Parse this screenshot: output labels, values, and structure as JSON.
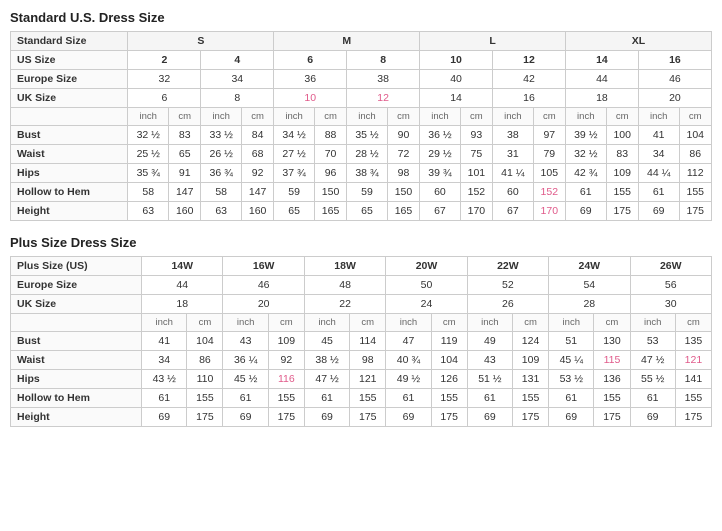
{
  "standardTitle": "Standard U.S. Dress Size",
  "plusTitle": "Plus Size Dress Size",
  "standard": {
    "sizeGroups": [
      "S",
      "M",
      "L",
      "XL"
    ],
    "usRow": {
      "label": "US Size",
      "values": [
        "2",
        "4",
        "6",
        "8",
        "10",
        "12",
        "14",
        "16"
      ]
    },
    "europeRow": {
      "label": "Europe Size",
      "values": [
        "32",
        "34",
        "36",
        "38",
        "40",
        "42",
        "44",
        "46"
      ]
    },
    "ukRow": {
      "label": "UK Size",
      "values": [
        "6",
        "8",
        "10",
        "12",
        "14",
        "16",
        "18",
        "20"
      ],
      "pink": [
        2,
        3
      ]
    },
    "measurements": [
      {
        "label": "Bust",
        "values": [
          "32 ½",
          "83",
          "33 ½",
          "84",
          "34 ½",
          "88",
          "35 ½",
          "90",
          "36 ½",
          "93",
          "38",
          "97",
          "39 ½",
          "100",
          "41",
          "104"
        ]
      },
      {
        "label": "Waist",
        "values": [
          "25 ½",
          "65",
          "26 ½",
          "68",
          "27 ½",
          "70",
          "28 ½",
          "72",
          "29 ½",
          "75",
          "31",
          "79",
          "32 ½",
          "83",
          "34",
          "86"
        ]
      },
      {
        "label": "Hips",
        "values": [
          "35 ¾",
          "91",
          "36 ¾",
          "92",
          "37 ¾",
          "96",
          "38 ¾",
          "98",
          "39 ¾",
          "101",
          "41 ¼",
          "105",
          "42 ¾",
          "109",
          "44 ¼",
          "112"
        ]
      },
      {
        "label": "Hollow to Hem",
        "values": [
          "58",
          "147",
          "58",
          "147",
          "59",
          "150",
          "59",
          "150",
          "60",
          "152",
          "60",
          "152",
          "61",
          "155",
          "61",
          "155"
        ],
        "pink": [
          10,
          11
        ]
      },
      {
        "label": "Height",
        "values": [
          "63",
          "160",
          "63",
          "160",
          "65",
          "165",
          "65",
          "165",
          "67",
          "170",
          "67",
          "170",
          "69",
          "175",
          "69",
          "175"
        ],
        "pink": [
          10,
          11
        ]
      }
    ]
  },
  "plus": {
    "sizeGroups": [
      "14W",
      "16W",
      "18W",
      "20W",
      "22W",
      "24W",
      "26W"
    ],
    "plusSizeRow": {
      "label": "Plus Size (US)",
      "values": [
        "14W",
        "16W",
        "18W",
        "20W",
        "22W",
        "24W",
        "26W"
      ]
    },
    "europeRow": {
      "label": "Europe Size",
      "values": [
        "44",
        "46",
        "48",
        "50",
        "52",
        "54",
        "56"
      ]
    },
    "ukRow": {
      "label": "UK Size",
      "values": [
        "18",
        "20",
        "22",
        "24",
        "26",
        "28",
        "30"
      ]
    },
    "measurements": [
      {
        "label": "Bust",
        "values": [
          "41",
          "104",
          "43",
          "109",
          "45",
          "114",
          "47",
          "119",
          "49",
          "124",
          "51",
          "130",
          "53",
          "135"
        ]
      },
      {
        "label": "Waist",
        "values": [
          "34",
          "86",
          "36 ¼",
          "92",
          "38 ½",
          "98",
          "40 ¾",
          "104",
          "43",
          "109",
          "45 ¼",
          "115",
          "47 ½",
          "121"
        ],
        "pink": [
          10,
          11,
          12,
          13
        ]
      },
      {
        "label": "Hips",
        "values": [
          "43 ½",
          "110",
          "45 ½",
          "116",
          "47 ½",
          "121",
          "49 ½",
          "126",
          "51 ½",
          "131",
          "53 ½",
          "136",
          "55 ½",
          "141"
        ],
        "pink": [
          2,
          3
        ]
      },
      {
        "label": "Hollow to Hem",
        "values": [
          "61",
          "155",
          "61",
          "155",
          "61",
          "155",
          "61",
          "155",
          "61",
          "155",
          "61",
          "155",
          "61",
          "155"
        ]
      },
      {
        "label": "Height",
        "values": [
          "69",
          "175",
          "69",
          "175",
          "69",
          "175",
          "69",
          "175",
          "69",
          "175",
          "69",
          "175",
          "69",
          "175"
        ]
      }
    ]
  }
}
